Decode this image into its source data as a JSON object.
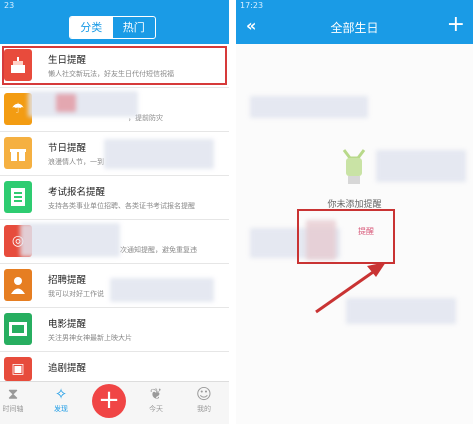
{
  "left": {
    "status_time": "23",
    "tabs": {
      "active": "分类",
      "inactive": "热门"
    },
    "items": [
      {
        "title": "生日提醒",
        "subtitle": "懒人社交新玩法，好友生日代付短信祝福",
        "icon": "cake-icon",
        "color": "#e84b3c"
      },
      {
        "title": "",
        "subtitle": "，提前防灾",
        "icon": "umbrella-icon",
        "color": "#f39c12"
      },
      {
        "title": "节日提醒",
        "subtitle": "浪漫情人节，一到",
        "icon": "gift-icon",
        "color": "#f5b041"
      },
      {
        "title": "考试报名提醒",
        "subtitle": "支持各类事业单位招聘、各类证书考试报名提醒",
        "icon": "document-icon",
        "color": "#2ecc71"
      },
      {
        "title": "",
        "subtitle": "次通知提醒，避免重复违",
        "icon": "target-icon",
        "color": "#e74c3c"
      },
      {
        "title": "招聘提醒",
        "subtitle": "我可以对好工作说",
        "icon": "person-icon",
        "color": "#e67e22"
      },
      {
        "title": "电影提醒",
        "subtitle": "关注男神女神最新上映大片",
        "icon": "film-icon",
        "color": "#27ae60"
      },
      {
        "title": "追剧提醒",
        "subtitle": "",
        "icon": "tv-icon",
        "color": "#e74c3c"
      }
    ],
    "nav": {
      "timeline": "时间轴",
      "discover": "发现",
      "add": "+",
      "today": "今天",
      "mine": "我的"
    }
  },
  "right": {
    "status_time": "17:23",
    "back": "«",
    "title": "全部生日",
    "add": "+",
    "empty_text": "你未添加提醒",
    "add_tip": "提醒"
  },
  "colors": {
    "accent": "#1a9be6",
    "highlight": "#d63a3a",
    "fab": "#f04545"
  }
}
